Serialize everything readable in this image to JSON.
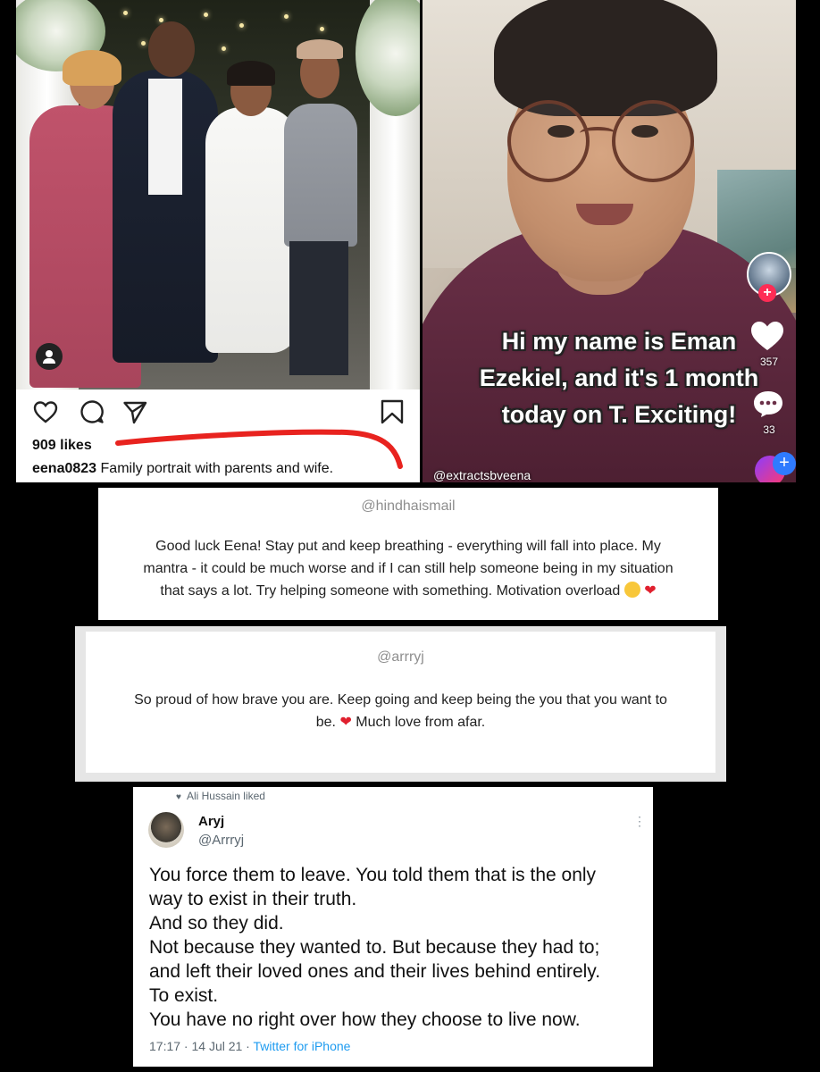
{
  "instagram": {
    "likes": "909 likes",
    "username": "eena0823",
    "caption": "Family portrait with parents and wife.",
    "underline_color": "#e8231f"
  },
  "tiktok": {
    "caption_lines": [
      "Hi my name is Eman",
      "Ezekiel, and it's 1 month",
      "today on T. Exciting!"
    ],
    "handle": "@extractsbveena",
    "like_count": "357",
    "comment_count": "33"
  },
  "comment_one": {
    "handle": "@hindhaismail",
    "lines": [
      "Good luck Eena! Stay put and keep breathing - everything will fall into place. My",
      "mantra - it could be much worse and if I can still help someone being in my situation",
      "that says a lot. Try helping someone with something. Motivation overload"
    ]
  },
  "comment_two": {
    "handle": "@arrryj",
    "line1": "So proud of how brave you are. Keep going and keep being the you that you want to",
    "line2a": "be.",
    "line2b": "Much love from afar."
  },
  "tweet": {
    "liked_by": "Ali Hussain liked",
    "display_name": "Aryj",
    "handle": "@Arrryj",
    "lines": [
      "You force them to leave. You told them that is the only",
      "way to exist in their truth.",
      "And so they did.",
      "Not because they wanted to. But because they had to;",
      "and left their loved ones and their lives behind entirely.",
      "To exist.",
      "You have no right over how they choose to live now."
    ],
    "timestamp": "17:17 · 14 Jul 21 · ",
    "source": "Twitter for iPhone",
    "link_color": "#1d9bf0"
  }
}
